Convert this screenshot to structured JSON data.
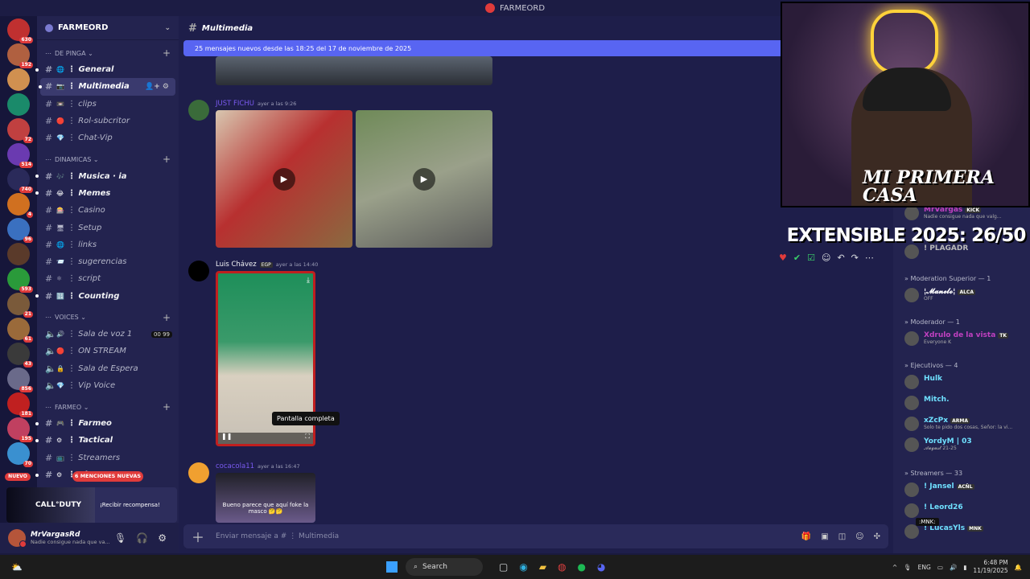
{
  "window": {
    "title": "FARMEORD"
  },
  "server_rail": {
    "badges": [
      "630",
      "192",
      "",
      "",
      "72",
      "514",
      "740",
      "4",
      "96",
      "",
      "593",
      "21",
      "61",
      "43",
      "856",
      "181",
      "195",
      "70"
    ],
    "new_label": "NUEVO"
  },
  "guild": {
    "name": "FARMEORD"
  },
  "categories": [
    {
      "name": "DE PINGA",
      "channels": [
        {
          "emoji": "🌐",
          "name": "General",
          "bold": true
        },
        {
          "emoji": "📷",
          "name": "Multimedia",
          "active": true
        },
        {
          "emoji": "📼",
          "name": "clips"
        },
        {
          "emoji": "🔴",
          "name": "Rol-subcritor"
        },
        {
          "emoji": "💎",
          "name": "Chat-Vip"
        }
      ]
    },
    {
      "name": "DINAMICAS",
      "channels": [
        {
          "emoji": "🎶",
          "name": "Musica · ia",
          "bold": true
        },
        {
          "emoji": "😂",
          "name": "Memes",
          "bold": true
        },
        {
          "emoji": "🎰",
          "name": "Casino"
        },
        {
          "emoji": "🖥",
          "name": "Setup"
        },
        {
          "emoji": "🌐",
          "name": "links"
        },
        {
          "emoji": "📨",
          "name": "sugerencias"
        },
        {
          "emoji": "⚛",
          "name": "script"
        },
        {
          "emoji": "🔢",
          "name": "Counting",
          "bold": true
        }
      ]
    },
    {
      "name": "VOICES",
      "channels": [
        {
          "emoji": "🔊",
          "name": "Sala de voz 1",
          "count": "00 99"
        },
        {
          "emoji": "🔴",
          "name": "ON STREAM"
        },
        {
          "emoji": "🔒",
          "name": "Sala de Espera"
        },
        {
          "emoji": "💎",
          "name": "Vip Voice"
        }
      ]
    },
    {
      "name": "FARMEO",
      "channels": [
        {
          "emoji": "🎮",
          "name": "Farmeo",
          "bold": true
        },
        {
          "emoji": "⚙",
          "name": "Tactical",
          "bold": true
        },
        {
          "emoji": "📺",
          "name": "Streamers"
        },
        {
          "emoji": "⚙",
          "name": "Chat",
          "bold": true
        }
      ]
    }
  ],
  "mentions_pill": "6 MENCIONES NUEVAS",
  "promo": {
    "game": "CALL°DUTY",
    "cta": "¡Recibir recompensa!"
  },
  "user": {
    "name": "MrVargasRd",
    "status": "Nadie consigue nada que va..."
  },
  "channel_header": {
    "name": "Multimedia"
  },
  "new_messages_bar": "25 mensajes nuevos desde las 18:25 del 17 de noviembre de 2025",
  "messages": [
    {
      "author": "JUST FICHU",
      "time": "ayer a las 9:26"
    },
    {
      "author": "Luis Chávez",
      "tag": "EGP",
      "time": "ayer a las 14:40"
    },
    {
      "author": "cocacola11",
      "time": "ayer a las 16:47",
      "preview_text": "Bueno parece que aquí foke la masco 🤔🤔"
    }
  ],
  "tooltip": "Pantalla completa",
  "composer": {
    "placeholder": "Enviar mensaje a # ⋮ Multimedia"
  },
  "overlay": {
    "cam_caption": "MI PRIMERA CASA",
    "title": "EXTENSIBLE 2025: 26/50"
  },
  "members": {
    "top_items": [
      {
        "name": "MrVargas",
        "badge": "KICK",
        "status": "Nadie consigue nada que valg..."
      },
      {
        "name": "! PLAGADR"
      }
    ],
    "groups": [
      {
        "label": "Moderation Superior — 1",
        "items": [
          {
            "name": "¦𝓜𝓪𝓷𝓮𝓵𝓸¦",
            "badge": "ALCA",
            "status": "OFF",
            "color": "#ffffff"
          }
        ]
      },
      {
        "label": "Moderador — 1",
        "items": [
          {
            "name": "Xdrulo de la vista",
            "badge": "TK",
            "status": "Everyone K",
            "color": "#c040c0"
          }
        ]
      },
      {
        "label": "Ejecutivos — 4",
        "items": [
          {
            "name": "Hulk",
            "color": "#6fe0ff"
          },
          {
            "name": "Mitch.",
            "color": "#6fe0ff"
          },
          {
            "name": "xZcPx",
            "badge": "ARMA",
            "status": "Solo te pido dos cosas, Señor: la vi...",
            "color": "#6fe0ff"
          },
          {
            "name": "YordyM | 03",
            "status": "𝓐𝓾𝓰𝓾𝓼𝓽 21-25",
            "color": "#6fe0ff"
          }
        ]
      },
      {
        "label": "Streamers — 33",
        "items": [
          {
            "name": "! Jansel",
            "badge": "ACÑL",
            "color": "#6fe0ff"
          },
          {
            "name": "! Leord26",
            "color": "#6fe0ff"
          },
          {
            "name": "! LucasYls",
            "badge": "MNK",
            "color": "#6fe0ff"
          }
        ]
      }
    ],
    "hover_label": ":MNK:"
  },
  "taskbar": {
    "search": "Search",
    "lang": "ENG",
    "time": "6:48 PM",
    "date": "11/19/2025"
  }
}
